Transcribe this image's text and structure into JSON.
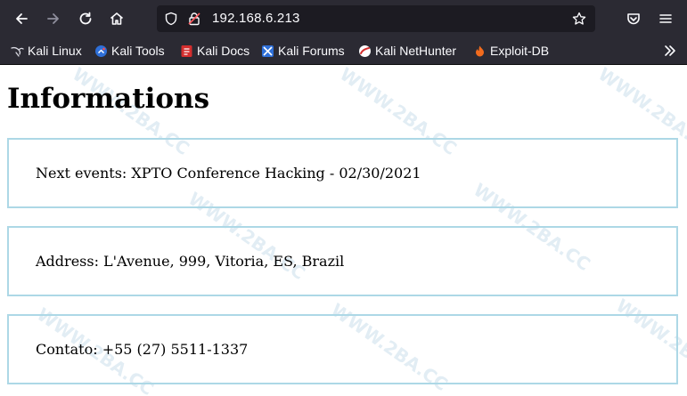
{
  "browser": {
    "url": "192.168.6.213",
    "bookmarks": [
      {
        "label": "Kali Linux",
        "icon": "kali-dragon-icon"
      },
      {
        "label": "Kali Tools",
        "icon": "kali-tools-icon"
      },
      {
        "label": "Kali Docs",
        "icon": "kali-docs-icon"
      },
      {
        "label": "Kali Forums",
        "icon": "kali-forums-icon"
      },
      {
        "label": "Kali NetHunter",
        "icon": "kali-nethunter-icon"
      },
      {
        "label": "Exploit-DB",
        "icon": "exploit-db-icon"
      }
    ]
  },
  "page": {
    "title": "Informations",
    "items": [
      {
        "text": "Next events: XPTO Conference Hacking - 02/30/2021"
      },
      {
        "text": "Address: L'Avenue, 999, Vitoria, ES, Brazil"
      },
      {
        "text": "Contato: +55 (27) 5511-1337"
      }
    ]
  },
  "watermark": {
    "text": "WWW.2BA.CC"
  },
  "colors": {
    "chrome_bg": "#2b2a33",
    "urlbar_bg": "#1c1b22",
    "box_border": "#add8e6"
  }
}
